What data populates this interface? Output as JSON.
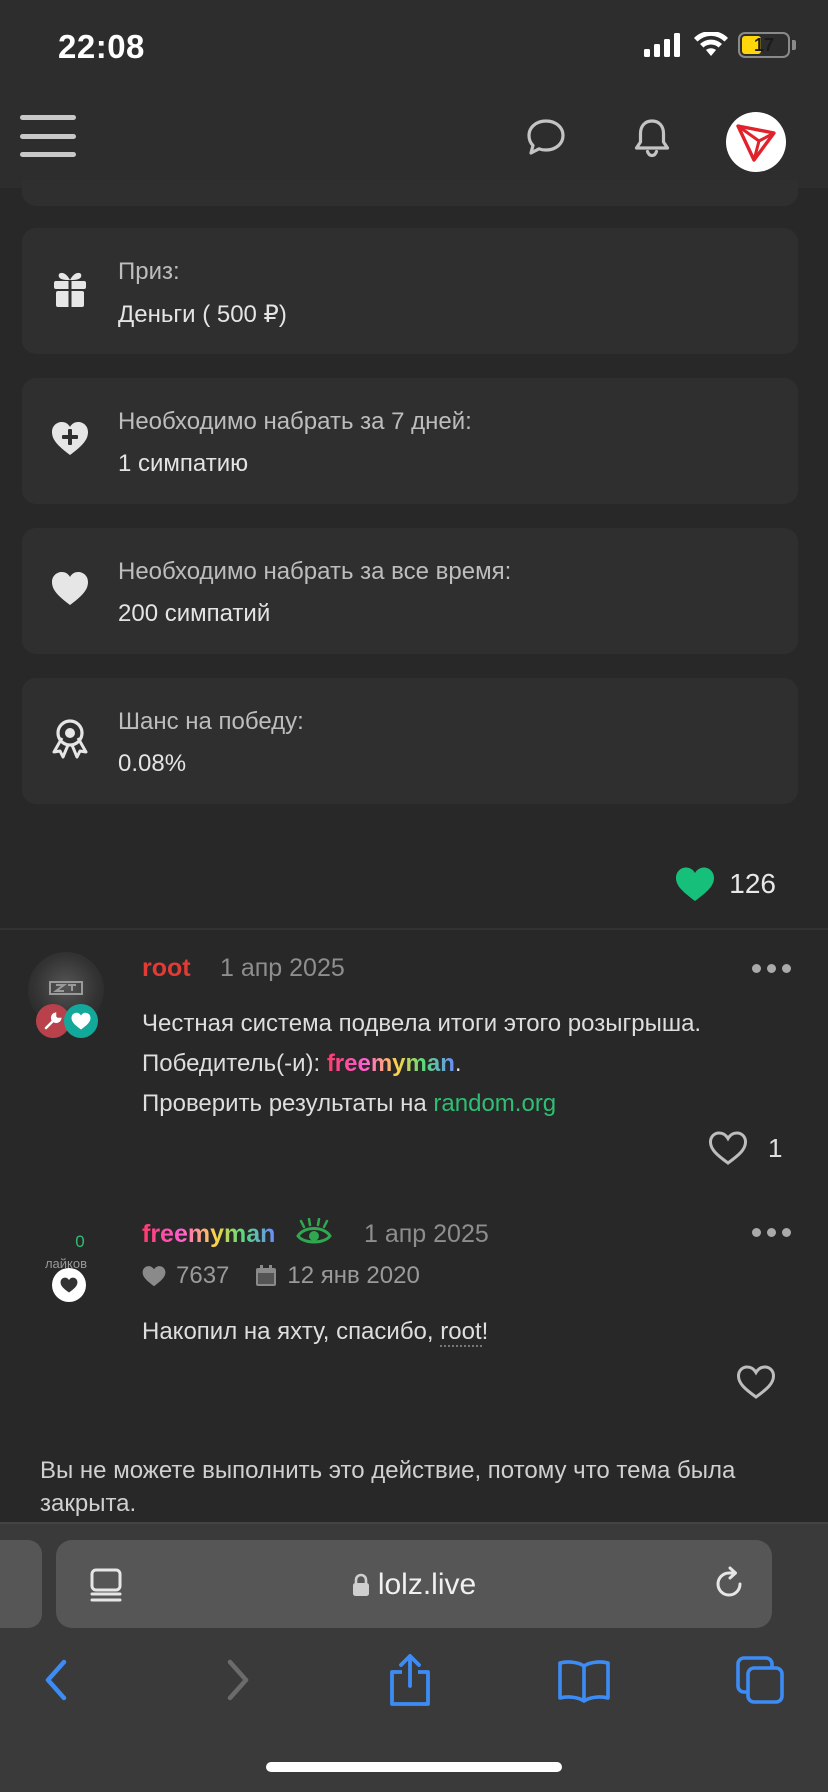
{
  "status_bar": {
    "time": "22:08",
    "battery_percent": "17"
  },
  "header": {
    "menu_icon": "hamburger-icon",
    "chat_icon": "chat-bubble-icon",
    "bell_icon": "bell-icon",
    "avatar_icon": "tron-logo-icon"
  },
  "contest_info": [
    {
      "icon": "gift-icon",
      "label": "Приз:",
      "value": "Деньги ( 500 ₽)"
    },
    {
      "icon": "heart-plus-icon",
      "label": "Необходимо набрать за 7 дней:",
      "value": "1 симпатию"
    },
    {
      "icon": "heart-icon",
      "label": "Необходимо набрать за все время:",
      "value": "200 симпатий"
    },
    {
      "icon": "award-ribbon-icon",
      "label": "Шанс на победу:",
      "value": "0.08%"
    }
  ],
  "thread_likes": "126",
  "posts": [
    {
      "user": "root",
      "user_color": "#e03b35",
      "date": "1 апр 2025",
      "lines": {
        "line1": "Честная система подвела итоги этого розыгрыша.",
        "line2_prefix": "Победитель(-и): ",
        "winner": "freemyman",
        "line2_suffix": ".",
        "line3_prefix": "Проверить результаты на ",
        "link": "random.org"
      },
      "likes": "1"
    },
    {
      "user": "freemyman",
      "date": "1 апр 2025",
      "likes_badge_count": "0",
      "likes_badge_label": "лайков",
      "user_likes": "7637",
      "registered": "12 янв 2020",
      "text_prefix": "Накопил на яхту, спасибо, ",
      "mention": "root",
      "text_suffix": "!"
    }
  ],
  "closed_note": "Вы не можете выполнить это действие, потому что тема была закрыта.",
  "browser": {
    "url": "lolz.live",
    "accent": "#3d8cf5"
  }
}
